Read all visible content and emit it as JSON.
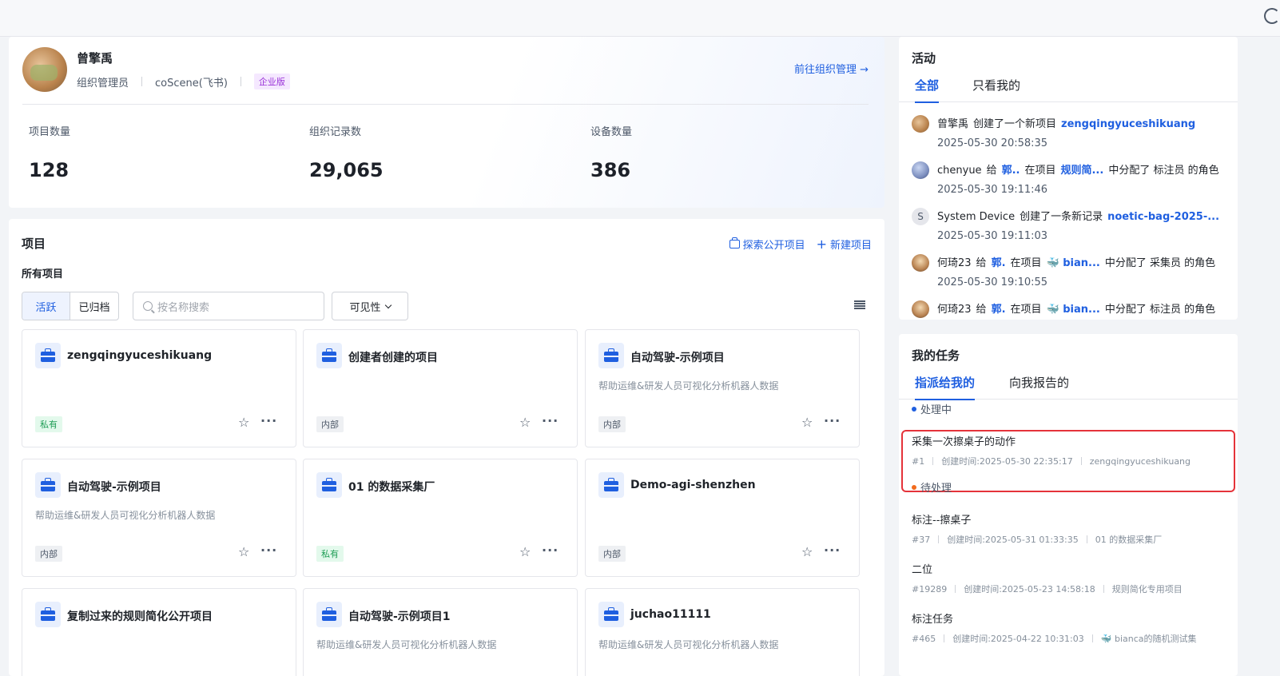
{
  "profile": {
    "name": "曾擎禹",
    "role": "组织管理员",
    "org": "coScene(飞书)",
    "edition": "企业版",
    "org_link": "前往组织管理 →",
    "stats": [
      {
        "label": "项目数量",
        "value": "128"
      },
      {
        "label": "组织记录数",
        "value": "29,065"
      },
      {
        "label": "设备数量",
        "value": "386"
      }
    ]
  },
  "projects": {
    "title": "项目",
    "explore": "探索公开项目",
    "create": "新建项目",
    "subtitle": "所有项目",
    "seg_active": "活跃",
    "seg_archived": "已归档",
    "search_placeholder": "按名称搜索",
    "visibility": "可见性",
    "cards": [
      {
        "name": "zengqingyuceshikuang",
        "desc": "",
        "tag": "私有"
      },
      {
        "name": "创建者创建的项目",
        "desc": "",
        "tag": "内部"
      },
      {
        "name": "自动驾驶-示例项目",
        "desc": "帮助运维&研发人员可视化分析机器人数据",
        "tag": "内部"
      },
      {
        "name": "自动驾驶-示例项目",
        "desc": "帮助运维&研发人员可视化分析机器人数据",
        "tag": "内部"
      },
      {
        "name": "01 的数据采集厂",
        "desc": "",
        "tag": "私有"
      },
      {
        "name": "Demo-agi-shenzhen",
        "desc": "",
        "tag": "内部"
      },
      {
        "name": "复制过来的规则简化公开项目",
        "desc": "",
        "tag": ""
      },
      {
        "name": "自动驾驶-示例项目1",
        "desc": "帮助运维&研发人员可视化分析机器人数据",
        "tag": ""
      },
      {
        "name": "juchao11111",
        "desc": "帮助运维&研发人员可视化分析机器人数据",
        "tag": ""
      }
    ]
  },
  "activity": {
    "title": "活动",
    "tab_all": "全部",
    "tab_mine": "只看我的",
    "items": [
      {
        "user": "曾擎禹",
        "a1": "创建了一个新项目",
        "l1": "zengqingyuceshikuang",
        "a2": "",
        "l2": "",
        "a3": "",
        "time": "2025-05-30 20:58:35",
        "avatar": "S0"
      },
      {
        "user": "chenyue",
        "a1": "给",
        "l1": "郭..",
        "a2": "在项目",
        "l2": "规则简...",
        "a3": "中分配了 标注员 的角色",
        "time": "2025-05-30 19:11:46",
        "avatar": "S1"
      },
      {
        "user": "System Device",
        "a1": "创建了一条新记录",
        "l1": "noetic-bag-2025-...",
        "a2": "",
        "l2": "",
        "a3": "",
        "time": "2025-05-30 19:11:03",
        "avatar": "S"
      },
      {
        "user": "何琦23",
        "a1": "给",
        "l1": "郭.",
        "a2": "在项目",
        "l2": "🐳 bian...",
        "a3": "中分配了 采集员 的角色",
        "time": "2025-05-30 19:10:55",
        "avatar": "S3"
      },
      {
        "user": "何琦23",
        "a1": "给",
        "l1": "郭.",
        "a2": "在项目",
        "l2": "🐳 bian...",
        "a3": "中分配了 标注员 的角色",
        "time": "",
        "avatar": "S3"
      }
    ]
  },
  "tasks": {
    "title": "我的任务",
    "tab_assigned": "指派给我的",
    "tab_reported": "向我报告的",
    "group_processing": "处理中",
    "group_pending": "待处理",
    "items": [
      {
        "title": "采集一次擦桌子的动作",
        "id": "#1",
        "created": "创建时间:2025-05-30 22:35:17",
        "project": "zengqingyuceshikuang"
      },
      {
        "title": "标注--擦桌子",
        "id": "#37",
        "created": "创建时间:2025-05-31 01:33:35",
        "project": "01 的数据采集厂"
      },
      {
        "title": "二位",
        "id": "#19289",
        "created": "创建时间:2025-05-23 14:58:18",
        "project": "规则简化专用项目"
      },
      {
        "title": "标注任务",
        "id": "#465",
        "created": "创建时间:2025-04-22 10:31:03",
        "project": "🐳 bianca的随机测试集"
      }
    ]
  },
  "colors": {
    "accent": "#1f5fe0",
    "highlight": "#e5333a",
    "processing": "#1f5fe0",
    "pending": "#f26b1d"
  }
}
